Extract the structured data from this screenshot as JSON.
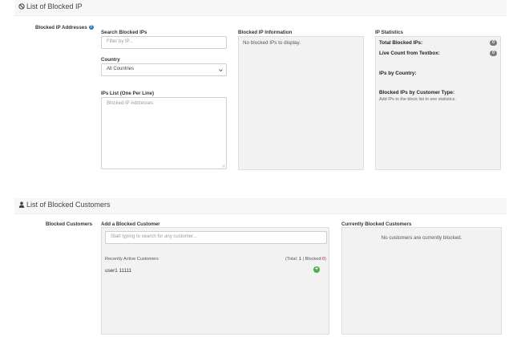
{
  "ip_section": {
    "title": "List of Blocked IP",
    "row_label": "Blocked IP Addresses",
    "help": "?",
    "search": {
      "label": "Search Blocked IPs",
      "placeholder": "Filter by IP..."
    },
    "country": {
      "label": "Country",
      "selected": "All Countries"
    },
    "ips_list": {
      "label": "IPs List (One Per Line)",
      "placeholder": "Blocked IP Addresses"
    },
    "info": {
      "title": "Blocked IP Information",
      "empty": "No blocked IPs to display."
    },
    "stats": {
      "title": "IP Statistics",
      "total_label": "Total Blocked IPs:",
      "total_value": "0",
      "live_label": "Live Count from Textbox:",
      "live_value": "0",
      "by_country_label": "IPs by Country:",
      "by_customer_type_label": "Blocked IPs by Customer Type:",
      "hint": "Add IPs to the block list to see statistics."
    }
  },
  "customer_section": {
    "title": "List of Blocked Customers",
    "row_label": "Blocked Customers",
    "add": {
      "title": "Add a Blocked Customer",
      "search_placeholder": "Start typing to search for any customer...",
      "recent_label": "Recently Active Customers",
      "total_prefix": "(Total:",
      "total_value": "1",
      "separator": "|",
      "blocked_label": "Blocked:",
      "blocked_value": "0",
      "close_paren": ")",
      "customers": [
        {
          "name": "user1 11111"
        }
      ]
    },
    "current": {
      "title": "Currently Blocked Customers",
      "empty": "No customers are currently blocked."
    }
  },
  "icons": {
    "ban": "ban-icon",
    "user": "user-icon",
    "add": "plus-circle-icon",
    "help": "question-icon",
    "dropdown": "chevron-down-icon"
  },
  "colors": {
    "total_value": "#3c8d3c",
    "blocked_value": "#d9534f",
    "add_button": "#4cae4c",
    "help": "#2a7fc4"
  }
}
